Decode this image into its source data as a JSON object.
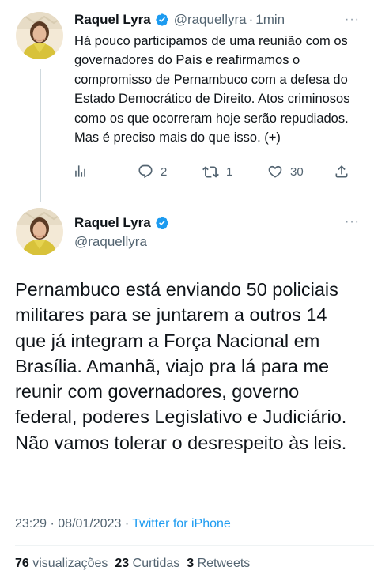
{
  "tweet1": {
    "author_name": "Raquel Lyra",
    "handle": "@raquellyra",
    "separator": "·",
    "time": "1min",
    "more": "···",
    "text": "Há pouco participamos de uma reunião com os governadores do País e reafirmamos o compromisso de Pernambuco com a defesa do Estado Democrático de Direito. Atos criminosos como os que ocorreram hoje serão repudiados. Mas é preciso mais do que isso. (+)",
    "actions": {
      "replies": "2",
      "retweets": "1",
      "likes": "30"
    }
  },
  "tweet2": {
    "author_name": "Raquel Lyra",
    "handle": "@raquellyra",
    "more": "···",
    "text": "Pernambuco está enviando 50 policiais militares para se juntarem a outros 14 que já integram a Força Nacional em Brasília. Amanhã, viajo pra lá para me reunir com governadores, governo federal, poderes Legislativo e Judiciário. Não vamos tolerar o desrespeito às leis.",
    "meta": {
      "time": "23:29",
      "separator1": "·",
      "date": "08/01/2023",
      "separator2": "·",
      "source": "Twitter for iPhone"
    },
    "stats": {
      "views_count": "76",
      "views_label": "visualizações",
      "likes_count": "23",
      "likes_label": "Curtidas",
      "retweets_count": "3",
      "retweets_label": "Retweets"
    }
  },
  "colors": {
    "text": "#0f1419",
    "secondary": "#536471",
    "link": "#1d9bf0",
    "verified": "#1d9bf0",
    "thread_line": "#cfd9de"
  },
  "icons": {
    "verified": "verified-badge-icon",
    "views": "analytics-bars-icon",
    "reply": "reply-bubble-icon",
    "retweet": "retweet-arrows-icon",
    "like": "heart-icon",
    "share": "share-upload-icon",
    "more": "more-dots-icon"
  }
}
